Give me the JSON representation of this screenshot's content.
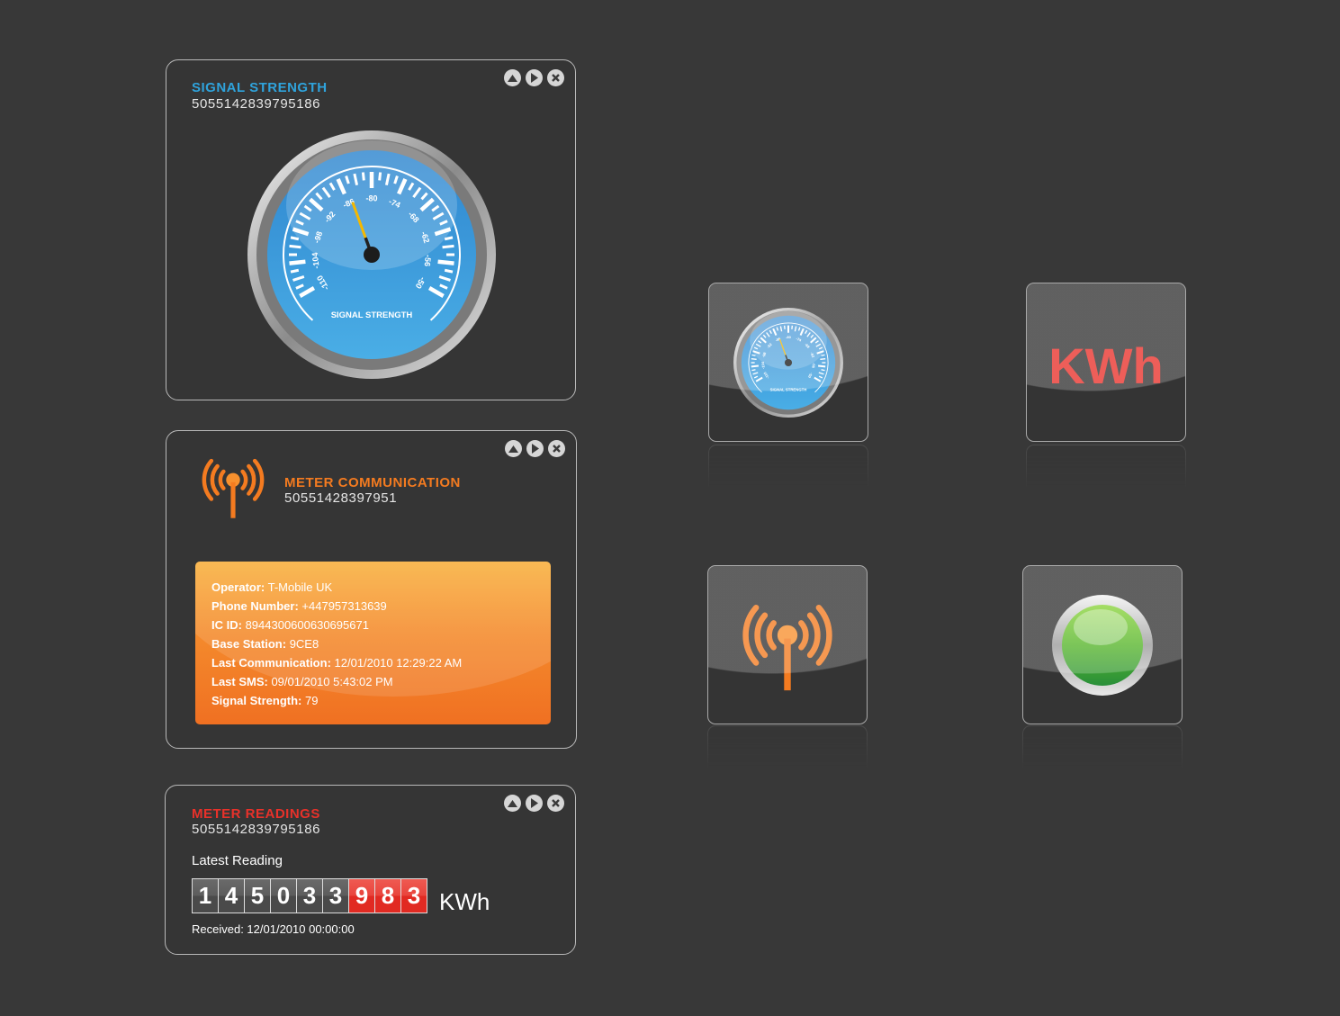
{
  "window_controls": {
    "up_icon": "triangle-up",
    "next_icon": "triangle-right",
    "close_icon": "x"
  },
  "signal_panel": {
    "title": "SIGNAL STRENGTH",
    "id": "5055142839795186",
    "title_color": "#2fa3dc",
    "gauge": {
      "label": "SIGNAL STRENGTH",
      "min": -110,
      "max": -50,
      "tick_labels": [
        "-110",
        "-104",
        "-98",
        "-92",
        "-86",
        "-80",
        "-74",
        "-68",
        "-62",
        "-56",
        "-50"
      ],
      "needle_value": -85,
      "face_color": "#3b9ad9",
      "needle_color": "#f5b800"
    }
  },
  "comm_panel": {
    "title": "METER COMMUNICATION",
    "id": "50551428397951",
    "title_color": "#f47b20",
    "icon": "antenna-icon",
    "details": [
      {
        "label": "Operator:",
        "value": "T-Mobile UK"
      },
      {
        "label": "Phone Number:",
        "value": "+447957313639"
      },
      {
        "label": "IC ID:",
        "value": "8944300600630695671"
      },
      {
        "label": "Base Station:",
        "value": "9CE8"
      },
      {
        "label": "Last Communication:",
        "value": "12/01/2010 12:29:22 AM"
      },
      {
        "label": "Last SMS:",
        "value": "09/01/2010 5:43:02 PM"
      },
      {
        "label": "Signal Strength:",
        "value": "79"
      }
    ]
  },
  "readings_panel": {
    "title": "METER READINGS",
    "id": "5055142839795186",
    "title_color": "#e8312a",
    "latest_label": "Latest Reading",
    "digits": [
      "1",
      "4",
      "5",
      "0",
      "3",
      "3",
      "9",
      "8",
      "3"
    ],
    "red_digit_count": 3,
    "unit": "KWh",
    "received": "Received: 12/01/2010 00:00:00"
  },
  "tiles": {
    "kwh_label": "KWh",
    "kwh_color": "#e8312a",
    "status_color": "#3aa82e"
  }
}
